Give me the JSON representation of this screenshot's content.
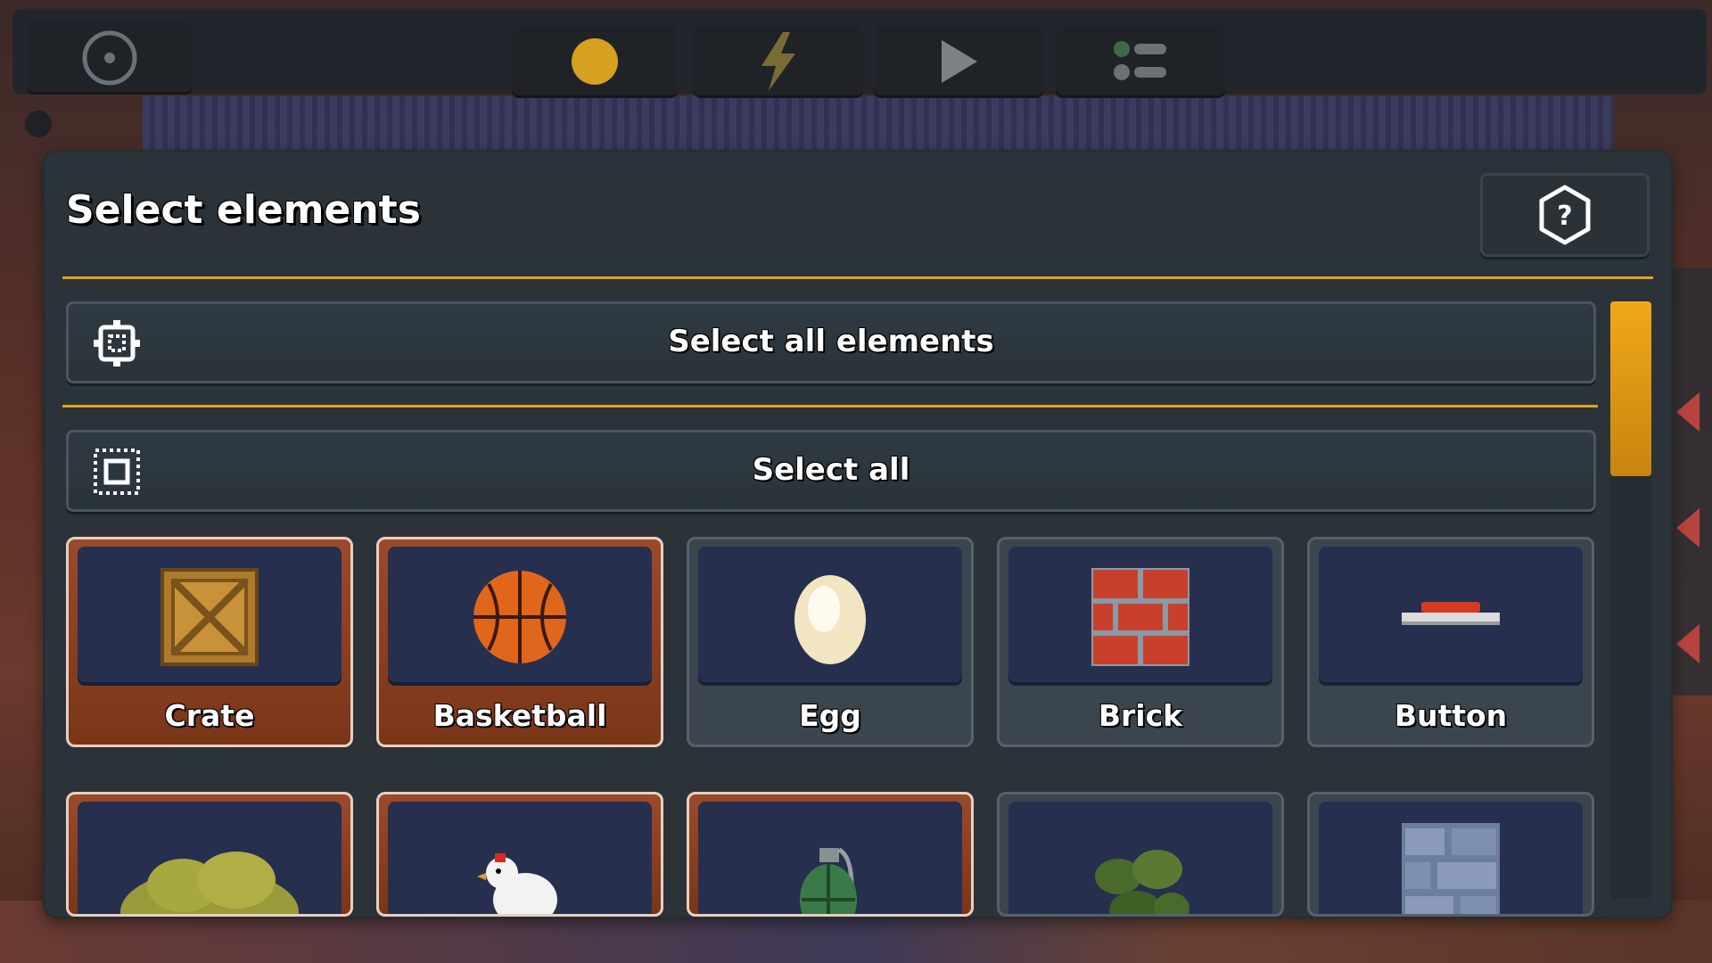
{
  "toolbar": {
    "buttons": [
      {
        "name": "settings",
        "icon": "target-icon"
      },
      {
        "name": "sun",
        "icon": "sun-icon"
      },
      {
        "name": "bolt",
        "icon": "lightning-icon"
      },
      {
        "name": "play",
        "icon": "play-icon"
      },
      {
        "name": "list",
        "icon": "list-icon"
      }
    ]
  },
  "panel": {
    "title": "Select elements",
    "help_icon": "help-hexagon-icon",
    "select_all_elements_label": "Select all elements",
    "select_all_label": "Select all"
  },
  "elements": [
    {
      "label": "Crate",
      "selected": true,
      "icon": "crate-icon"
    },
    {
      "label": "Basketball",
      "selected": true,
      "icon": "basketball-icon"
    },
    {
      "label": "Egg",
      "selected": false,
      "icon": "egg-icon"
    },
    {
      "label": "Brick",
      "selected": false,
      "icon": "brick-icon"
    },
    {
      "label": "Button",
      "selected": false,
      "icon": "button-icon"
    },
    {
      "label": "",
      "selected": true,
      "icon": "bush-icon"
    },
    {
      "label": "",
      "selected": true,
      "icon": "chicken-icon"
    },
    {
      "label": "",
      "selected": true,
      "icon": "grenade-icon"
    },
    {
      "label": "",
      "selected": false,
      "icon": "leaves-icon"
    },
    {
      "label": "",
      "selected": false,
      "icon": "stone-wall-icon"
    }
  ],
  "colors": {
    "accent": "#e0a224",
    "panel_bg": "#2c3338",
    "selected_tile": "#8a4020",
    "tile_inner": "#262f4e"
  }
}
